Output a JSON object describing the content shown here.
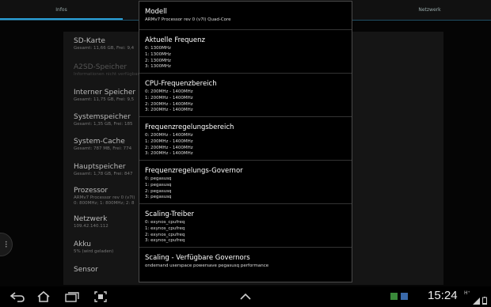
{
  "tabs": {
    "info": "Infos",
    "network": "Netzwerk"
  },
  "background_list": {
    "items": [
      {
        "title": "SD-Karte",
        "subtitle": "Gesamt: 11,66 GB, Frei: 9,4",
        "dim": false
      },
      {
        "title": "A2SD-Speicher",
        "subtitle": "Informationen nicht verfügbar",
        "dim": true
      },
      {
        "title": "Interner Speicher",
        "subtitle": "Gesamt: 11,75 GB, Frei: 9,5",
        "dim": false
      },
      {
        "title": "Systemspeicher",
        "subtitle": "Gesamt: 1,35 GB, Frei: 185",
        "dim": false
      },
      {
        "title": "System-Cache",
        "subtitle": "Gesamt: 787 MB, Frei: 774",
        "dim": false
      },
      {
        "title": "Hauptspeicher",
        "subtitle": "Gesamt: 1,78 GB, Frei: 847",
        "dim": false
      },
      {
        "title": "Prozessor",
        "subtitle": "ARMv7 Processor rev 0 (v7l)",
        "subtitle2": "0: 800MHz; 1: 800MHz; 2: 8",
        "dim": false
      },
      {
        "title": "Netzwerk",
        "subtitle": "109.42.140.112",
        "dim": false
      },
      {
        "title": "Akku",
        "subtitle": "5% (wird geladen)",
        "dim": false
      },
      {
        "title": "Sensor",
        "subtitle": "",
        "dim": false
      }
    ]
  },
  "dialog": {
    "sections": [
      {
        "title": "Modell",
        "lines": [
          "ARMv7 Processor rev 0 (v7l) Quad-Core"
        ]
      },
      {
        "title": "Aktuelle Frequenz",
        "lines": [
          "0: 1300MHz",
          "1: 1300MHz",
          "2: 1300MHz",
          "3: 1300MHz"
        ]
      },
      {
        "title": "CPU-Frequenzbereich",
        "lines": [
          "0: 200MHz - 1400MHz",
          "1: 200MHz - 1400MHz",
          "2: 200MHz - 1400MHz",
          "3: 200MHz - 1400MHz"
        ]
      },
      {
        "title": "Frequenzregelungsbereich",
        "lines": [
          "0: 200MHz - 1400MHz",
          "1: 200MHz - 1400MHz",
          "2: 200MHz - 1400MHz",
          "3: 200MHz - 1400MHz"
        ]
      },
      {
        "title": "Frequenzregelungs-Governor",
        "lines": [
          "0: pegasusq",
          "1: pegasusq",
          "2: pegasusq",
          "3: pegasusq"
        ]
      },
      {
        "title": "Scaling-Treiber",
        "lines": [
          "0: exynos_cpufreq",
          "1: exynos_cpufreq",
          "2: exynos_cpufreq",
          "3: exynos_cpufreq"
        ]
      },
      {
        "title": "Scaling - Verfügbare Governors",
        "lines": [
          "ondemand userspace powersave pegasusq performance"
        ]
      }
    ]
  },
  "navbar": {
    "icons": [
      "back-icon",
      "home-icon",
      "recent-apps-icon",
      "screenshot-icon",
      "up-chevron-icon"
    ],
    "clock": "15:24",
    "status_icons": [
      "notification-green-icon",
      "notification-blue-icon",
      "h-plus-icon",
      "signal-icon",
      "battery-icon"
    ]
  },
  "colors": {
    "accent": "#2a9fd6",
    "dialog_border": "#4a4a4a"
  }
}
